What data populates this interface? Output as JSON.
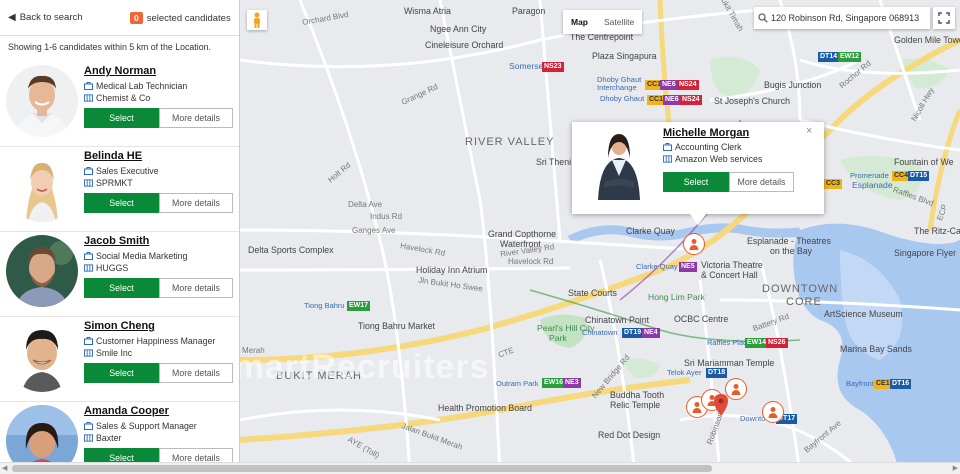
{
  "header": {
    "back_label": "Back to search",
    "selected_count": "0",
    "selected_label": "selected candidates",
    "showing_text": "Showing 1-6 candidates within 5 km of the Location."
  },
  "candidates": [
    {
      "name": "Andy Norman",
      "title": "Medical Lab Technician",
      "company": "Chemist & Co",
      "select_label": "Select",
      "details_label": "More details"
    },
    {
      "name": "Belinda HE",
      "title": "Sales Executive",
      "company": "SPRMKT",
      "select_label": "Select",
      "details_label": "More details"
    },
    {
      "name": "Jacob Smith",
      "title": "Social Media Marketing",
      "company": "HUGGS",
      "select_label": "Select",
      "details_label": "More details"
    },
    {
      "name": "Simon Cheng",
      "title": "Customer Happiness Manager",
      "company": "Smile Inc",
      "select_label": "Select",
      "details_label": "More details"
    },
    {
      "name": "Amanda Cooper",
      "title": "Sales & Support Manager",
      "company": "Baxter",
      "select_label": "Select",
      "details_label": "More details"
    }
  ],
  "map": {
    "type_map": "Map",
    "type_satellite": "Satellite",
    "search_value": "120 Robinson Rd, Singapore 068913",
    "watermark": "SmartRecruiters",
    "popup": {
      "name": "Michelle Morgan",
      "title": "Accounting Clerk",
      "company": "Amazon Web services",
      "select_label": "Select",
      "details_label": "More details",
      "close_glyph": "×"
    },
    "labels": {
      "river_valley": "RIVER VALLEY",
      "downtown_core_1": "DOWNTOWN",
      "downtown_core_2": "CORE",
      "bukit_merah": "BUKIT MERAH",
      "wisma_atria": "Wisma Atria",
      "paragon": "Paragon",
      "ngee_ann": "Ngee Ann City",
      "centrepoint": "The Centrepoint",
      "cineleisure": "Cineleisure Orchard",
      "plaza_sing": "Plaza Singapura",
      "somerset": "Somerset",
      "dhoby1": "Dhoby Ghaut",
      "dhoby2": "Interchange",
      "dhoby3": "Dhoby Ghaut",
      "st_joseph": "St Joseph's Church",
      "bugis_junction": "Bugis Junction",
      "golden_mile": "Golden Mile Towe",
      "fountain": "Fountain of We",
      "esplanade_stn": "Esplanade",
      "promenade": "Promenade",
      "grand_copthorne_1": "Grand Copthorne",
      "grand_copthorne_2": "Waterfront",
      "holiday_inn": "Holiday Inn Atrium",
      "delta_sports": "Delta Sports Complex",
      "clarke_quay": "Clarke Quay",
      "clarke_quay_stn": "Clarke Quay",
      "victoria_1": "Victoria Theatre",
      "victoria_2": "& Concert Hall",
      "esplanade_th_1": "Esplanade - Theatres",
      "esplanade_th_2": "on the Bay",
      "singapore_flyer": "Singapore Flyer",
      "ritz": "The Ritz-Ca",
      "state_courts": "State Courts",
      "hong_lim": "Hong Lim Park",
      "chinatown_point": "Chinatown Point",
      "chinatown": "Chinatown",
      "ocbc": "OCBC Centre",
      "raffles_place": "Raffles Place",
      "artscience": "ArtScience Museum",
      "marina_bay_sands": "Marina Bay Sands",
      "pearls_hill_1": "Pearl's Hill City",
      "pearls_hill_2": "Park",
      "sri_mariamman": "Sri Mariamman Temple",
      "telok_ayer": "Telok Ayer",
      "outram_park": "Outram Park",
      "tiong_bahru": "Tiong Bahru",
      "tiong_bahru_market": "Tiong Bahru Market",
      "buddha_1": "Buddha Tooth",
      "buddha_2": "Relic Temple",
      "health_promo": "Health Promotion Board",
      "red_dot": "Red Dot Design",
      "downtown_stn": "Downtown",
      "bayfront": "Bayfront",
      "sri_then": "Sri Theni",
      "grange_rd": "Grange Rd",
      "river_valley_rd": "River Valley Rd",
      "havelock_rd": "Havelock Rd",
      "havelock_rd2": "Havelock Rd",
      "ganges_ave": "Ganges Ave",
      "delta_ave": "Delta Ave",
      "indus_rd": "Indus Rd",
      "jln_bukit_ho_swee": "Jln Bukit Ho Swee",
      "jalan_bukit_merah": "Jalan Bukit Merah",
      "cte": "CTE",
      "aye": "AYE (Toll)",
      "new_bridge_rd": "New Bridge Rd",
      "robinson_rd": "Robinson Rd",
      "battery_rd": "Battery Rd",
      "holt_rd": "Holt Rd",
      "nicoll_hwy": "Nicoll Hwy",
      "rochor_rd": "Rochor Rd",
      "orchard_blvd": "Orchard Blvd",
      "bukit_timah": "Bukit Timah",
      "ecp": "ECP",
      "merah": "Merah",
      "raffles_blvd": "Raffles Blvd",
      "bayfront_ave": "Bayfront Ave"
    },
    "mrt_codes": {
      "ns23": "NS23",
      "ns24": "NS24",
      "cc1": "CC1",
      "ne6": "NE6",
      "dt14": "DT14",
      "ew12": "EW12",
      "cc3": "CC3",
      "cc4": "CC4",
      "dt15": "DT15",
      "ne5": "NE5",
      "ew17": "EW17",
      "dt19": "DT19",
      "ne4": "NE4",
      "ew14": "EW14",
      "ns26": "NS26",
      "dt18": "DT18",
      "ew16": "EW16",
      "ne3": "NE3",
      "dt17": "DT17",
      "ce1": "CE1",
      "dt16": "DT16"
    }
  }
}
